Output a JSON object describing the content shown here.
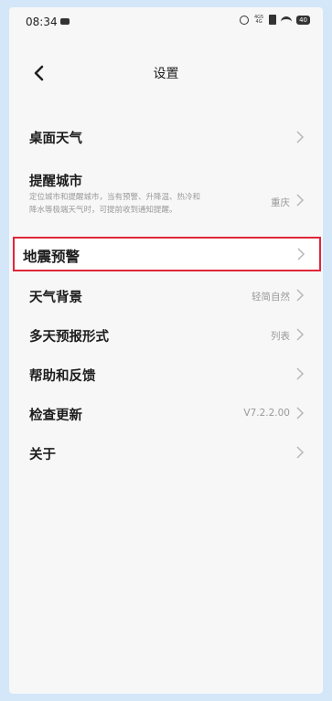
{
  "status_bar": {
    "time": "08:34",
    "network_top": "4G5",
    "network_bottom": "4G",
    "battery": "40"
  },
  "header": {
    "title": "设置"
  },
  "rows": [
    {
      "label": "桌面天气",
      "value": ""
    },
    {
      "label": "提醒城市",
      "value": "重庆",
      "subtitle_line1": "定位城市和提醒城市，当有预警、升降温、热冷和",
      "subtitle_line2": "降水等极端天气时，可提前收到通知提醒。"
    },
    {
      "label": "地震预警",
      "value": ""
    },
    {
      "label": "天气背景",
      "value": "轻简自然"
    },
    {
      "label": "多天预报形式",
      "value": "列表"
    },
    {
      "label": "帮助和反馈",
      "value": ""
    },
    {
      "label": "检查更新",
      "value": "V7.2.2.00"
    },
    {
      "label": "关于",
      "value": ""
    }
  ],
  "colors": {
    "highlight_border": "#e0263a",
    "background": "#d3e7f8"
  }
}
